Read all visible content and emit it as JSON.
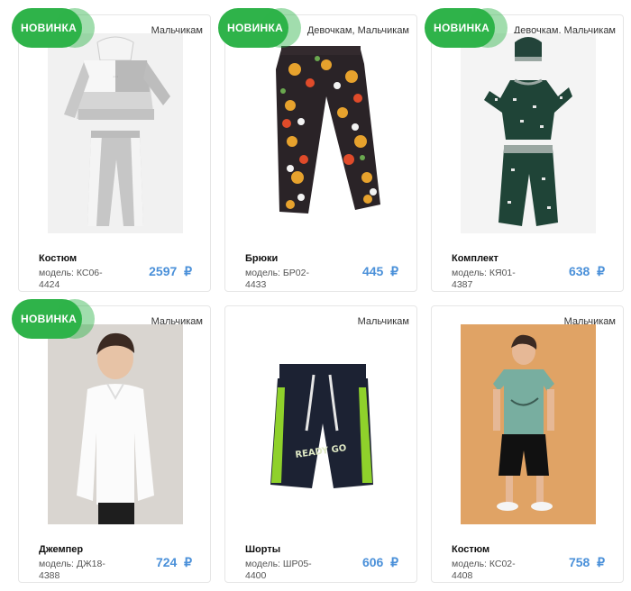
{
  "products": [
    {
      "badge": "НОВИНКА",
      "category": "Мальчикам",
      "name": "Костюм",
      "model": "модель: КС06-4424",
      "price": "2597",
      "currency": "₽"
    },
    {
      "badge": "НОВИНКА",
      "category": "Девочкам, Мальчикам",
      "name": "Брюки",
      "model": "модель: БР02-4433",
      "price": "445",
      "currency": "₽"
    },
    {
      "badge": "НОВИНКА",
      "category": "Девочкам, Мальчикам",
      "name": "Комплект",
      "model": "модель: КЯ01-4387",
      "price": "638",
      "currency": "₽"
    },
    {
      "badge": "НОВИНКА",
      "category": "Мальчикам",
      "name": "Джемпер",
      "model": "модель: ДЖ18-4388",
      "price": "724",
      "currency": "₽"
    },
    {
      "badge": "",
      "category": "Мальчикам",
      "name": "Шорты",
      "model": "модель: ШР05-4400",
      "price": "606",
      "currency": "₽"
    },
    {
      "badge": "",
      "category": "Мальчикам",
      "name": "Костюм",
      "model": "модель: КС02-4408",
      "price": "758",
      "currency": "₽"
    }
  ],
  "colors": {
    "badge": "#2fb34a",
    "price": "#4a90d9"
  },
  "shorts_print": "READY GO"
}
